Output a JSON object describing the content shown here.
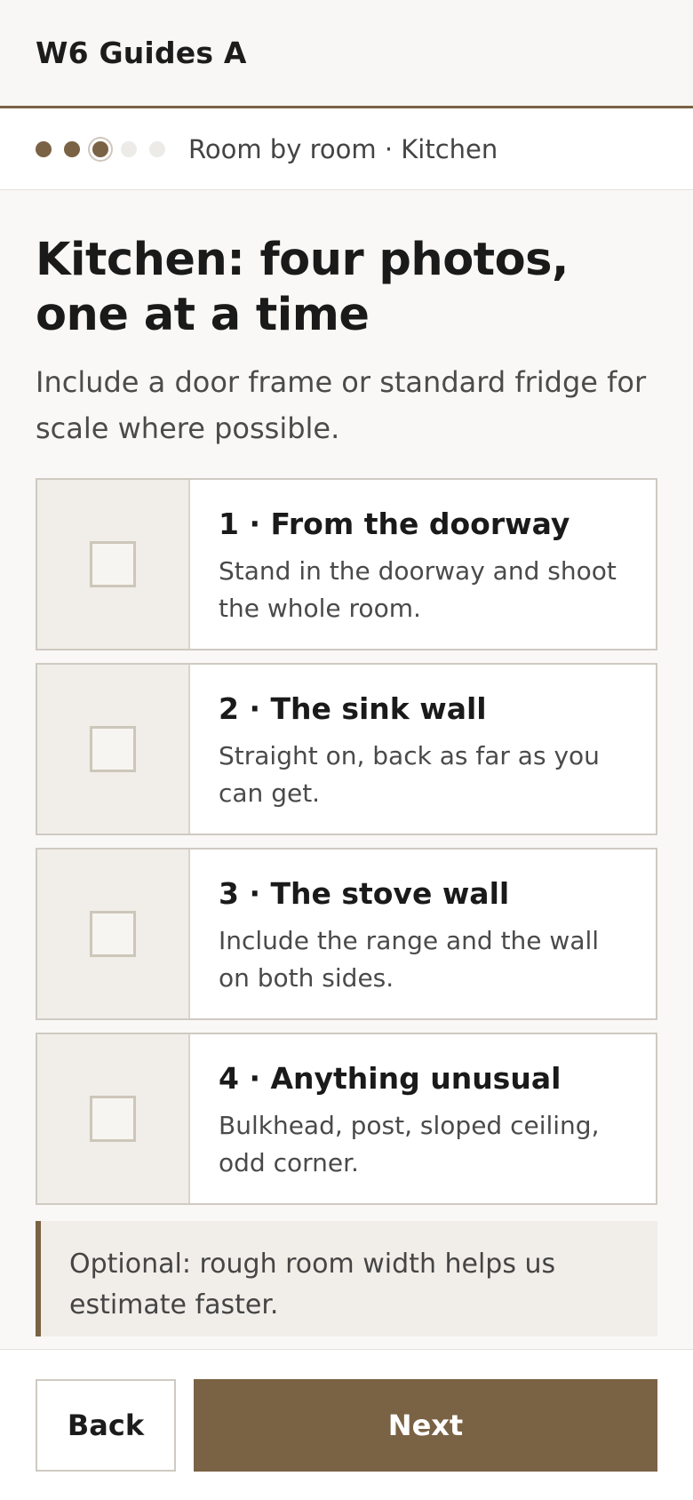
{
  "header": {
    "title": "W6 Guides A"
  },
  "progress": {
    "steps": [
      "done",
      "done",
      "current",
      "todo",
      "todo"
    ],
    "current_step": 3,
    "total_steps": 5,
    "label": "Room by room · Kitchen"
  },
  "page": {
    "title": "Kitchen: four photos, one at a time",
    "subtitle": "Include a door frame or standard fridge for scale where possible."
  },
  "shots": [
    {
      "title": "1 · From the doorway",
      "description": "Stand in the doorway and shoot the whole room.",
      "checked": false
    },
    {
      "title": "2 · The sink wall",
      "description": "Straight on, back as far as you can get.",
      "checked": false
    },
    {
      "title": "3 · The stove wall",
      "description": "Include the range and the wall on both sides.",
      "checked": false
    },
    {
      "title": "4 · Anything unusual",
      "description": "Bulkhead, post, sloped ceiling, odd corner.",
      "checked": false
    }
  ],
  "note": {
    "text": "Optional: rough room width helps us estimate faster."
  },
  "footer": {
    "back_label": "Back",
    "next_label": "Next"
  },
  "colors": {
    "accent": "#7a6244",
    "background": "#f9f8f6",
    "thumb_bg": "#f1eee9"
  }
}
